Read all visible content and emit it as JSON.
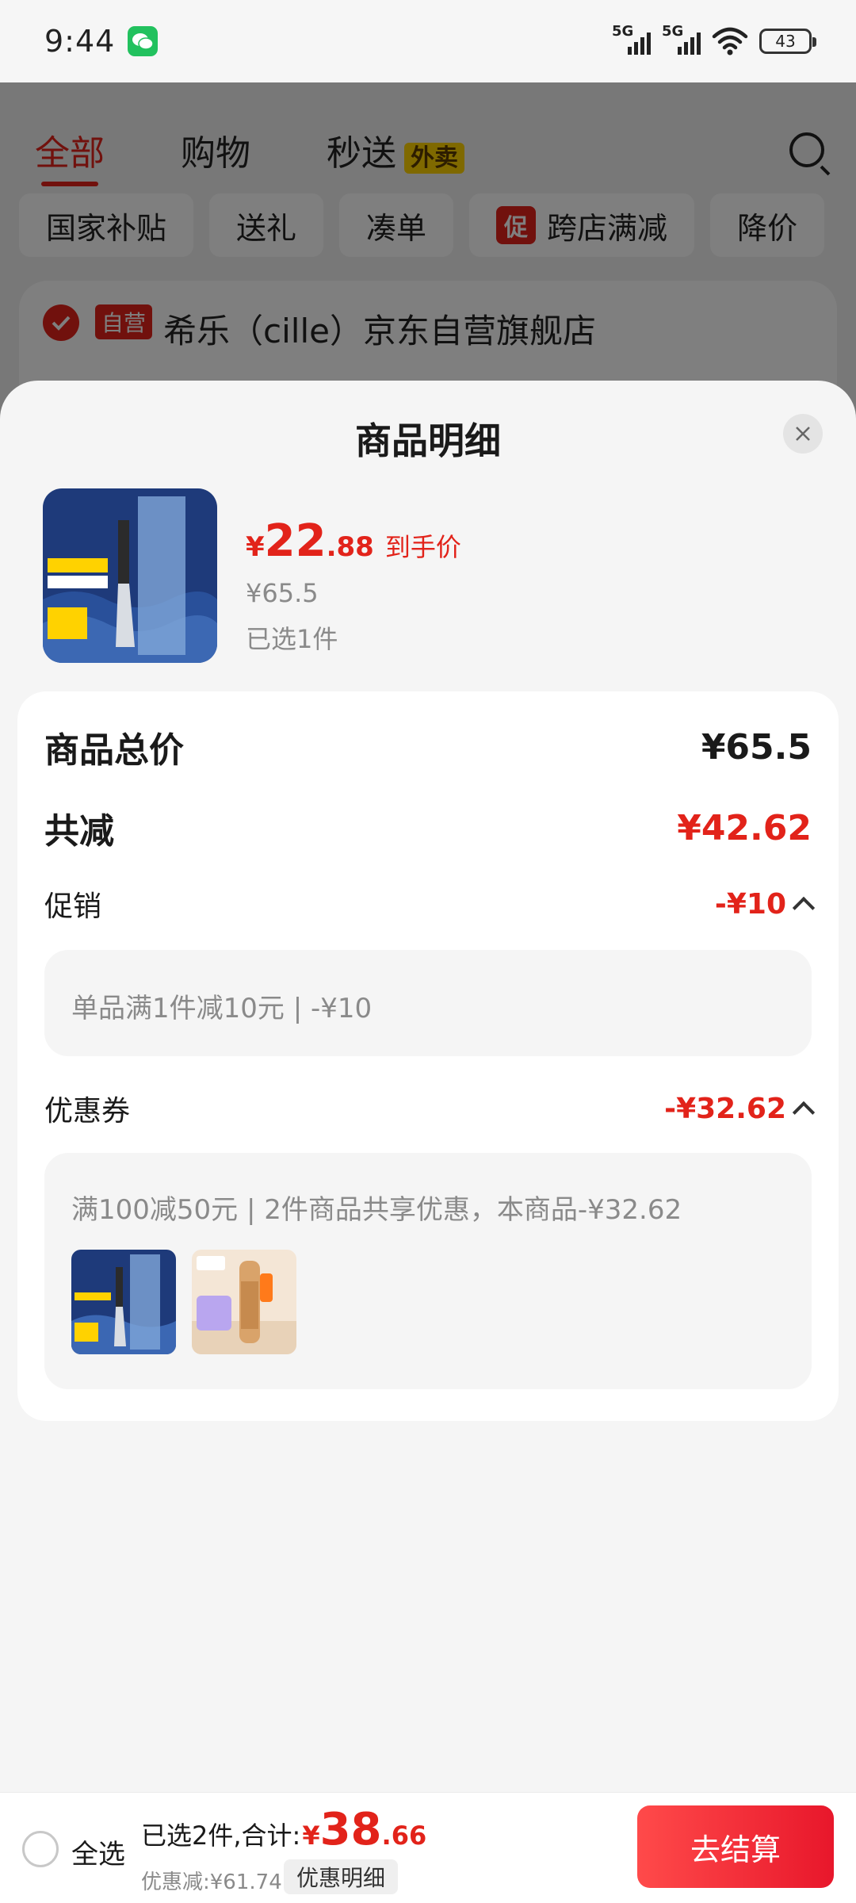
{
  "status_bar": {
    "time": "9:44",
    "network_1": "5G",
    "network_2": "5G",
    "battery": "43"
  },
  "background": {
    "tabs": [
      "全部",
      "购物",
      "秒送"
    ],
    "tab_badge": "外卖",
    "chips": [
      "国家补贴",
      "送礼",
      "凑单",
      "跨店满减",
      "降价"
    ],
    "promo_tag": "促",
    "store_tag": "自营",
    "store_name": "希乐（cille）京东自营旗舰店"
  },
  "sheet": {
    "title": "商品明细",
    "product": {
      "price_currency": "¥",
      "price_int": "22",
      "price_dec": ".88",
      "price_tag": "到手价",
      "original_price": "¥65.5",
      "selected_count": "已选1件"
    },
    "summary": {
      "total_label": "商品总价",
      "total_value": "¥65.5",
      "discount_label": "共减",
      "discount_value": "¥42.62",
      "promo_label": "促销",
      "promo_value": "-¥10",
      "promo_detail": "单品满1件减10元 | -¥10",
      "coupon_label": "优惠券",
      "coupon_value": "-¥32.62",
      "coupon_detail": "满100减50元 | 2件商品共享优惠，本商品-¥32.62"
    }
  },
  "bottom_bar": {
    "select_all": "全选",
    "summary_text": "已选2件,合计:",
    "total_currency": "¥",
    "total_int": "38",
    "total_dec": ".66",
    "saved_text": "优惠减:¥61.74",
    "detail_link": "优惠明细",
    "checkout": "去结算"
  },
  "colors": {
    "accent": "#e2231a",
    "muted": "#8a8a8a",
    "panel": "#f5f5f5"
  }
}
